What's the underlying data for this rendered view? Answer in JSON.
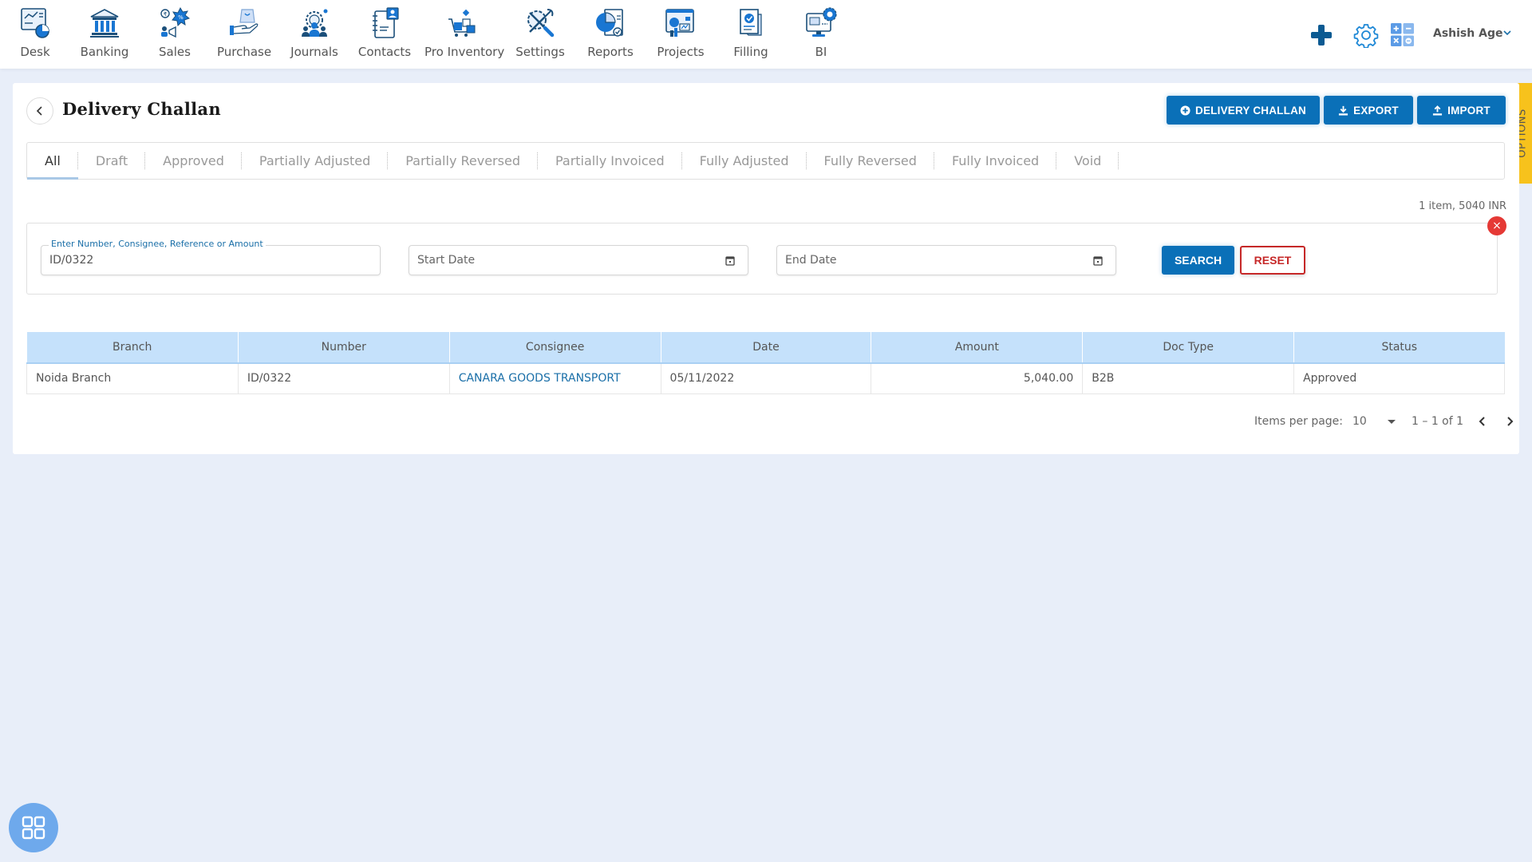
{
  "nav": {
    "items": [
      {
        "label": "Desk",
        "icon": "desk-icon"
      },
      {
        "label": "Banking",
        "icon": "bank-icon"
      },
      {
        "label": "Sales",
        "icon": "sales-icon"
      },
      {
        "label": "Purchase",
        "icon": "purchase-icon"
      },
      {
        "label": "Journals",
        "icon": "journals-icon"
      },
      {
        "label": "Contacts",
        "icon": "contacts-icon"
      },
      {
        "label": "Pro Inventory",
        "icon": "inventory-icon"
      },
      {
        "label": "Settings",
        "icon": "settings-tools-icon"
      },
      {
        "label": "Reports",
        "icon": "reports-icon"
      },
      {
        "label": "Projects",
        "icon": "projects-icon"
      },
      {
        "label": "Filling",
        "icon": "filling-icon"
      },
      {
        "label": "BI",
        "icon": "bi-icon"
      }
    ],
    "user_name": "Ashish Age"
  },
  "page": {
    "title": "Delivery Challan",
    "buttons": {
      "new": "DELIVERY CHALLAN",
      "export": "EXPORT",
      "import": "IMPORT"
    },
    "options_label": "OPTIONS"
  },
  "tabs": [
    "All",
    "Draft",
    "Approved",
    "Partially Adjusted",
    "Partially Reversed",
    "Partially Invoiced",
    "Fully Adjusted",
    "Fully Reversed",
    "Fully Invoiced",
    "Void"
  ],
  "active_tab": "All",
  "summary": "1 item, 5040 INR",
  "filters": {
    "search_label": "Enter Number, Consignee, Reference or Amount",
    "search_value": "ID/0322",
    "start_date_placeholder": "Start Date",
    "end_date_placeholder": "End Date",
    "search_button": "SEARCH",
    "reset_button": "RESET",
    "close_glyph": "×"
  },
  "table": {
    "columns": [
      "Branch",
      "Number",
      "Consignee",
      "Date",
      "Amount",
      "Doc Type",
      "Status"
    ],
    "rows": [
      {
        "branch": "Noida Branch",
        "number": "ID/0322",
        "consignee": "CANARA GOODS TRANSPORT",
        "date": "05/11/2022",
        "amount": "5,040.00",
        "doc_type": "B2B",
        "status": "Approved"
      }
    ]
  },
  "pagination": {
    "items_per_page_label": "Items per page:",
    "items_per_page": "10",
    "range": "1 – 1 of 1"
  },
  "colors": {
    "primary": "#0a70b8",
    "danger": "#c62828",
    "header_bg": "#c5e1fb",
    "options_tab": "#f7c21c",
    "link": "#1a6fa8"
  }
}
